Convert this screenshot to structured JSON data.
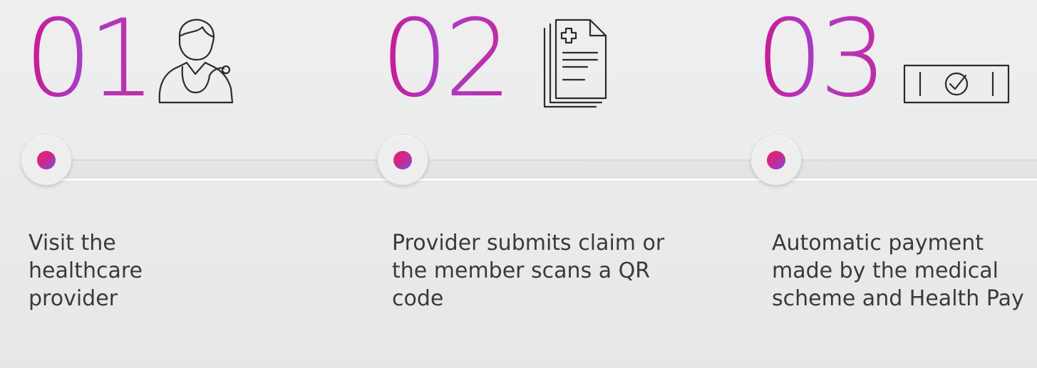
{
  "steps": [
    {
      "number": "01",
      "icon": "doctor-icon",
      "text": "Visit the healthcare provider"
    },
    {
      "number": "02",
      "icon": "medical-document-icon",
      "text": "Provider submits claim or the member scans a QR code"
    },
    {
      "number": "03",
      "icon": "payment-check-icon",
      "text": "Automatic payment made by the medical scheme and Health Pay"
    }
  ],
  "colors": {
    "number_gradient_start": "#d0158f",
    "number_gradient_end": "#a93cc7",
    "dot_gradient_start": "#f01e6f",
    "dot_gradient_end": "#7b4fe6",
    "text": "#3a3a3a"
  }
}
